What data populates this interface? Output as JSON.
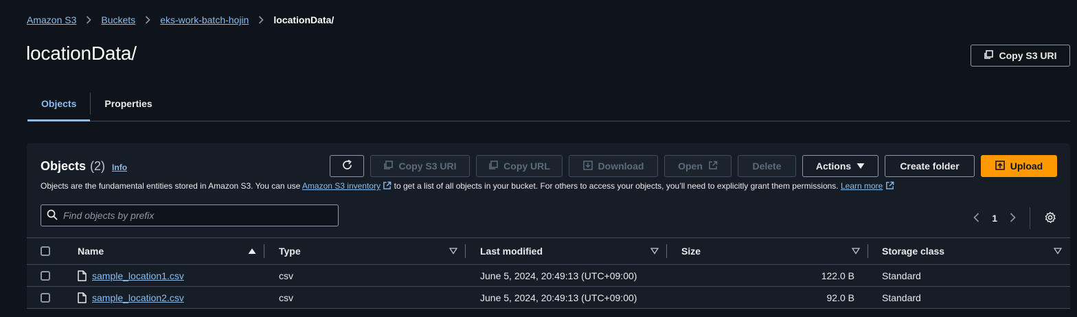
{
  "breadcrumb": {
    "items": [
      "Amazon S3",
      "Buckets",
      "eks-work-batch-hojin"
    ],
    "current": "locationData/"
  },
  "page": {
    "title": "locationData/",
    "copy_s3_uri": "Copy S3 URI"
  },
  "tabs": [
    {
      "label": "Objects",
      "active": true
    },
    {
      "label": "Properties",
      "active": false
    }
  ],
  "objects_panel": {
    "title": "Objects",
    "count": "(2)",
    "info": "Info",
    "description_pre": "Objects are the fundamental entities stored in Amazon S3. You can use ",
    "inventory_link": "Amazon S3 inventory",
    "description_mid": " to get a list of all objects in your bucket. For others to access your objects, you’ll need to explicitly grant them permissions. ",
    "learn_more": "Learn more",
    "toolbar": {
      "copy_s3_uri": "Copy S3 URI",
      "copy_url": "Copy URL",
      "download": "Download",
      "open": "Open",
      "delete": "Delete",
      "actions": "Actions",
      "create_folder": "Create folder",
      "upload": "Upload"
    },
    "search_placeholder": "Find objects by prefix",
    "page_number": "1"
  },
  "table": {
    "columns": [
      "Name",
      "Type",
      "Last modified",
      "Size",
      "Storage class"
    ],
    "rows": [
      {
        "name": "sample_location1.csv",
        "type": "csv",
        "modified": "June 5, 2024, 20:49:13 (UTC+09:00)",
        "size": "122.0 B",
        "storage_class": "Standard"
      },
      {
        "name": "sample_location2.csv",
        "type": "csv",
        "modified": "June 5, 2024, 20:49:13 (UTC+09:00)",
        "size": "92.0 B",
        "storage_class": "Standard"
      }
    ]
  },
  "colors": {
    "background": "#0f141a",
    "panel": "#161d26",
    "link": "#89bdee",
    "primary": "#ff9900"
  }
}
